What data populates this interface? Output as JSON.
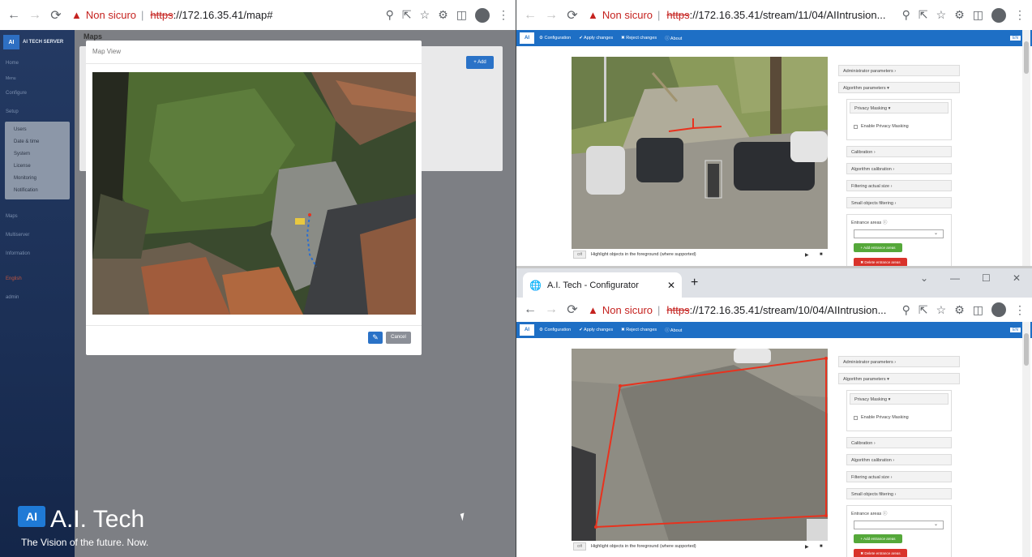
{
  "left_browser": {
    "security_label": "Non sicuro",
    "url_scheme": "https",
    "url_rest": "://172.16.35.41/map#"
  },
  "sidebar": {
    "logo_text": "AI",
    "brand": "AI TECH SERVER",
    "items": [
      {
        "label": "Home"
      },
      {
        "label": "Menu"
      },
      {
        "label": "Configure"
      },
      {
        "label": "Setup"
      }
    ],
    "setup_sub": [
      "Users",
      "Date & time",
      "System",
      "License",
      "Monitoring",
      "Notification"
    ],
    "items_bottom": [
      {
        "label": "Maps"
      },
      {
        "label": "Multiserver"
      },
      {
        "label": "Information"
      },
      {
        "label": "English"
      },
      {
        "label": "admin"
      }
    ]
  },
  "page": {
    "title": "Maps",
    "add_label": "+ Add"
  },
  "modal": {
    "title": "Map View",
    "cancel_label": "Cancel"
  },
  "watermark": {
    "logo": "AI",
    "brand": "A.I. Tech",
    "tagline": "The Vision of the future. Now."
  },
  "top_right_browser": {
    "security_label": "Non sicuro",
    "url_scheme": "https",
    "url_rest": "://172.16.35.41/stream/11/04/AIIntrusion..."
  },
  "bottom_right_browser": {
    "tab_title": "A.I. Tech - Configurator",
    "security_label": "Non sicuro",
    "url_scheme": "https",
    "url_rest": "://172.16.35.41/stream/10/04/AIIntrusion..."
  },
  "configurator": {
    "logo": "AI",
    "menu": [
      "Configuration",
      "Apply changes",
      "Reject changes",
      "About"
    ],
    "lang": "EN",
    "toggle_label": "Off",
    "highlight_label": "Highlight objects in the foreground (where supported)",
    "params": {
      "admin": "Administrator parameters",
      "algo": "Algorithm parameters",
      "privacy": "Privacy Masking",
      "enable_privacy": "Enable Privacy Masking",
      "calibration": "Calibration",
      "algo_calibration": "Algorithm calibration",
      "filtering": "Filtering actual size",
      "small_objects": "Small objects filtering",
      "entrance": "Entrance areas",
      "add_entrance": "Add entrance areas",
      "delete_entrance": "Delete entrance areas"
    }
  },
  "colors": {
    "chrome_insecure": "#c5221f",
    "app_blue": "#1e6fc5",
    "sidebar_navy": "#1b2f55",
    "roi_red": "#e8321e",
    "green_button": "#55a83a",
    "red_button": "#d9332b"
  }
}
